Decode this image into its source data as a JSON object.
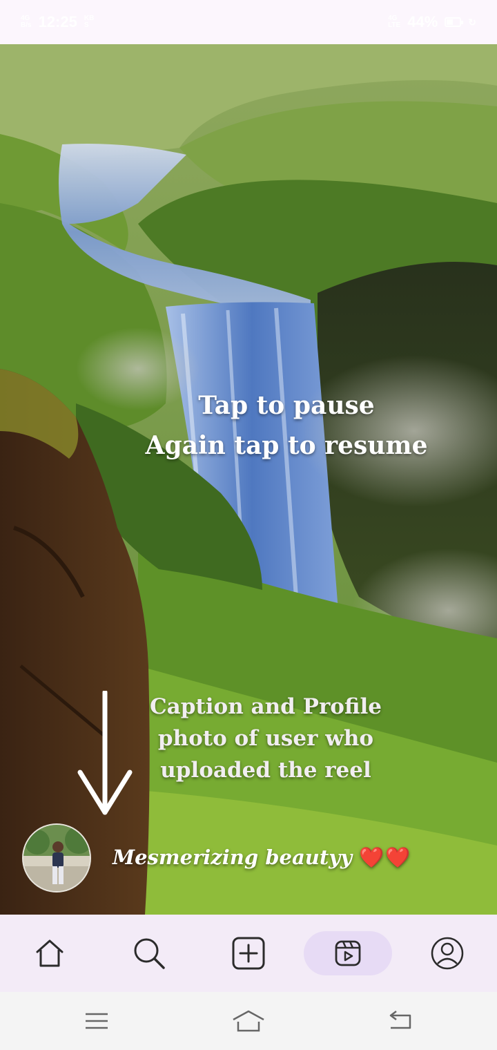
{
  "status_bar": {
    "network_left": "4G",
    "signal_speed": "B/s",
    "time": "12:25",
    "unit_top": "KB",
    "unit_bottom": "S",
    "network_right": "4G",
    "lte": "LTE",
    "battery_percent": "44%",
    "battery_level": 0.44
  },
  "reel": {
    "tap_hint_line1": "Tap to pause",
    "tap_hint_line2": "Again tap to resume",
    "caption_hint_line1": "Caption and Profile",
    "caption_hint_line2": "photo of user who",
    "caption_hint_line3": "uploaded the reel",
    "caption_text": "Mesmerizing beautyy",
    "caption_emoji": "❤️❤️",
    "avatar_icon": "user-profile-photo"
  },
  "bottom_nav": {
    "items": [
      {
        "name": "home",
        "icon": "home-icon"
      },
      {
        "name": "search",
        "icon": "search-icon"
      },
      {
        "name": "create",
        "icon": "add-box-icon"
      },
      {
        "name": "reels",
        "icon": "reels-icon",
        "active": true
      },
      {
        "name": "profile",
        "icon": "account-icon"
      }
    ]
  },
  "system_nav": {
    "icons": [
      "menu-icon",
      "home-outline-icon",
      "back-icon"
    ]
  },
  "colors": {
    "nav_background": "#f3ebf7",
    "nav_active": "#e7dbf5",
    "heart": "#e0201f",
    "icon_stroke": "#2b2b2b"
  }
}
